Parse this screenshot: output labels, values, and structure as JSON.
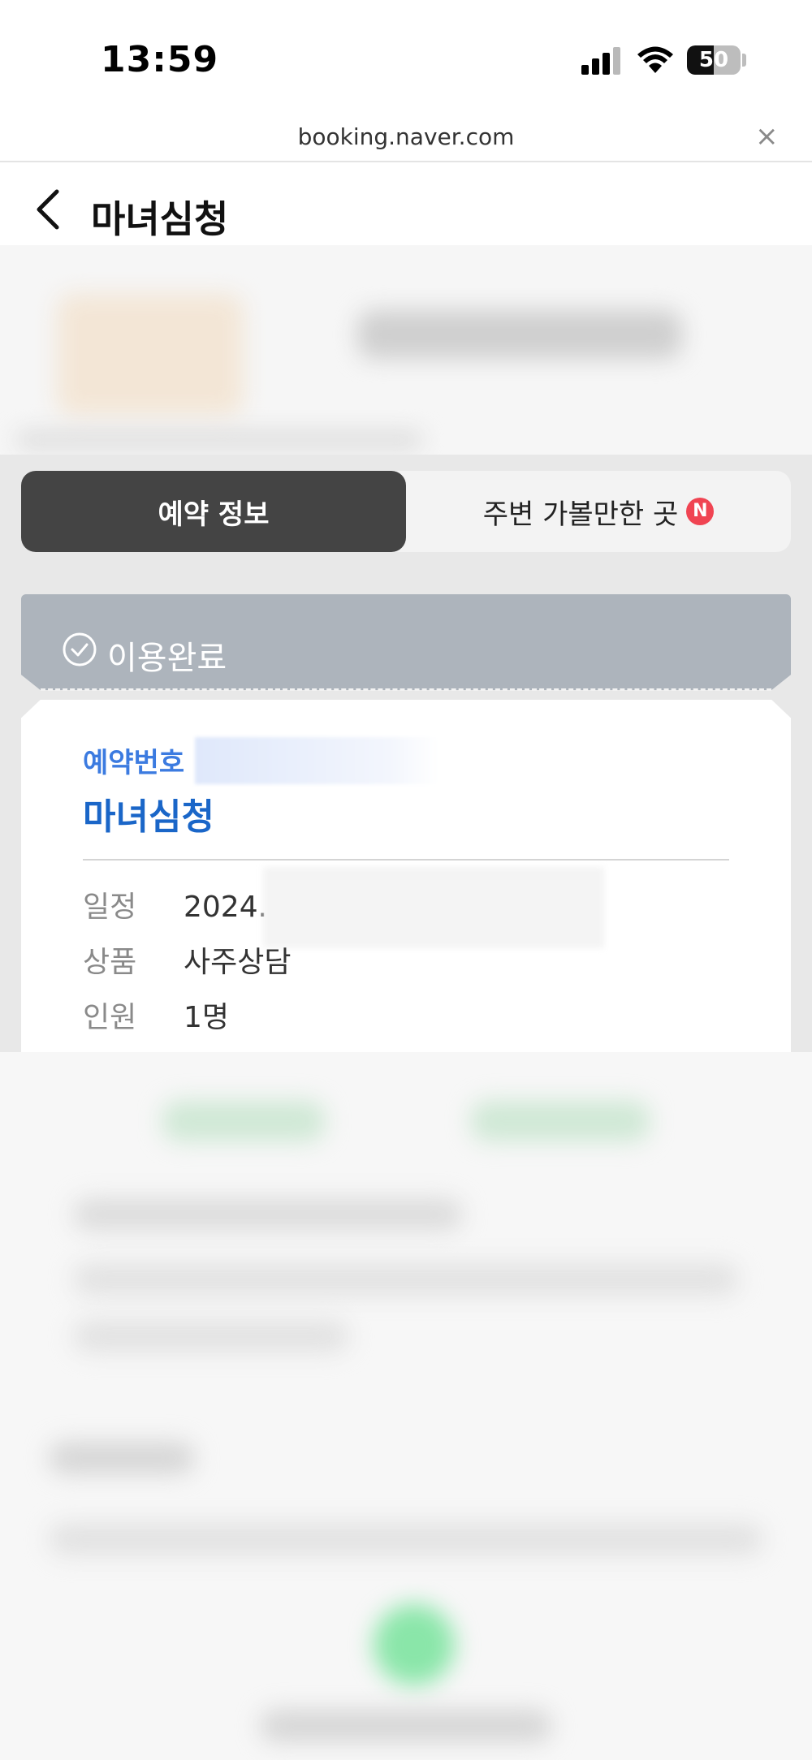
{
  "status_bar": {
    "time": "13:59",
    "battery_level": "50",
    "icons": [
      "signal-icon",
      "wifi-icon",
      "battery-icon"
    ]
  },
  "browser": {
    "url": "booking.naver.com",
    "close_glyph": "×"
  },
  "header": {
    "title": "마녀심청"
  },
  "tabs": [
    {
      "label": "예약 정보",
      "active": true
    },
    {
      "label": "주변 가볼만한 곳",
      "active": false,
      "badge": "N"
    }
  ],
  "reservation": {
    "status": "이용완료",
    "number_label": "예약번호",
    "shop_name": "마녀심청",
    "details": [
      {
        "label": "일정",
        "value": "2024."
      },
      {
        "label": "상품",
        "value": "사주상담"
      },
      {
        "label": "인원",
        "value": "1명"
      }
    ]
  },
  "colors": {
    "active_tab": "#444444",
    "status_strip": "#adb4bc",
    "reservation_number": "#3c7be0",
    "shop_name": "#1a66c8",
    "badge": "#f04452"
  }
}
